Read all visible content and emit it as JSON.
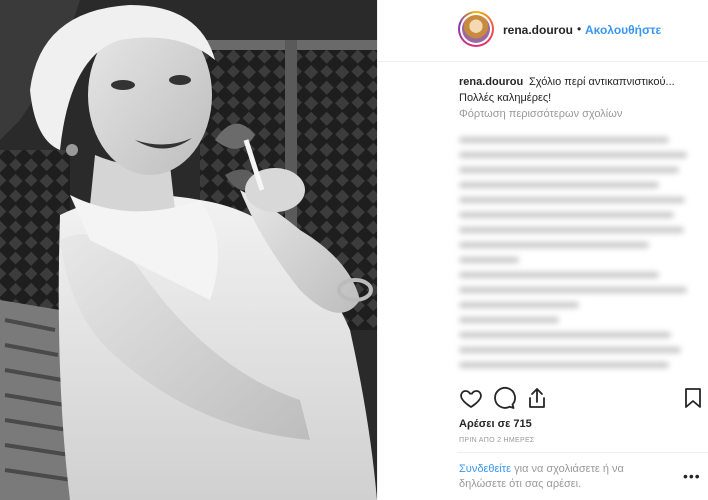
{
  "header": {
    "username": "rena.dourou",
    "separator": "•",
    "follow_label": "Ακολουθήστε"
  },
  "caption": {
    "username": "rena.dourou",
    "text": "Σχόλιο περί αντικαπνιστικού...",
    "line2": "Πολλές καλημέρες!",
    "load_more": "Φόρτωση περισσότερων σχολίων"
  },
  "actions": {
    "like_icon": "heart-icon",
    "comment_icon": "comment-icon",
    "share_icon": "share-icon",
    "save_icon": "bookmark-icon"
  },
  "likes_text": "Αρέσει σε 715",
  "time_text": "ΠΡΙΝ ΑΠΟ 2 ΗΜΕΡΕΣ",
  "login": {
    "link": "Συνδεθείτε",
    "text": " για να σχολιάσετε ή να δηλώσετε ότι σας αρέσει."
  },
  "more_options": "•••",
  "colors": {
    "link_blue": "#3897f0",
    "text": "#262626",
    "muted": "#999999"
  }
}
